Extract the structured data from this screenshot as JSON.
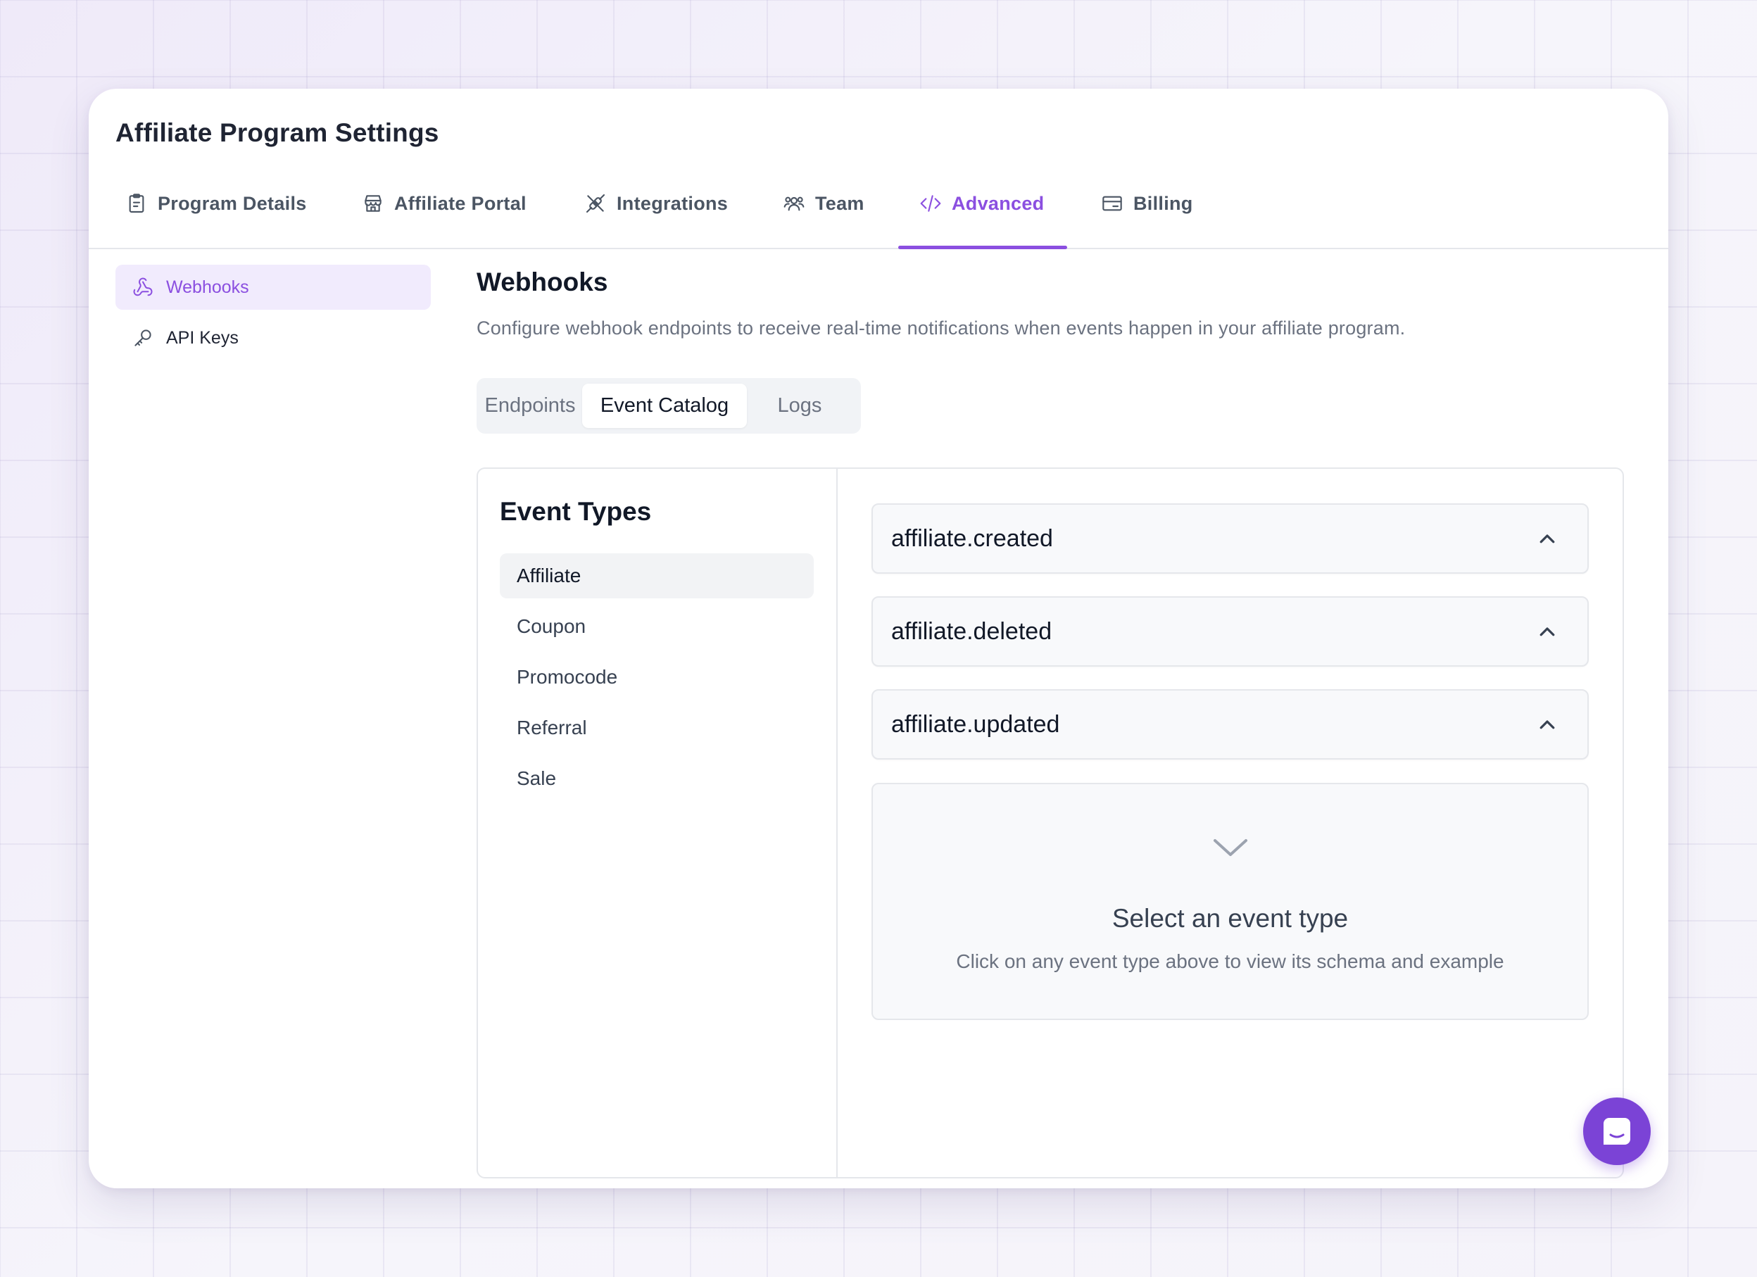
{
  "window": {
    "title": "Affiliate Program Settings"
  },
  "main_tabs": [
    {
      "label": "Program Details",
      "icon": "clipboard-icon"
    },
    {
      "label": "Affiliate Portal",
      "icon": "storefront-icon"
    },
    {
      "label": "Integrations",
      "icon": "plug-icon"
    },
    {
      "label": "Team",
      "icon": "users-icon"
    },
    {
      "label": "Advanced",
      "icon": "code-icon",
      "active": true
    },
    {
      "label": "Billing",
      "icon": "credit-card-icon"
    }
  ],
  "sidebar": {
    "items": [
      {
        "label": "Webhooks",
        "icon": "webhook-icon",
        "active": true
      },
      {
        "label": "API Keys",
        "icon": "key-icon"
      }
    ]
  },
  "section": {
    "title": "Webhooks",
    "description": "Configure webhook endpoints to receive real-time notifications when events happen in your affiliate program."
  },
  "sub_tabs": [
    {
      "label": "Endpoints"
    },
    {
      "label": "Event Catalog",
      "active": true
    },
    {
      "label": "Logs"
    }
  ],
  "event_types": {
    "title": "Event Types",
    "items": [
      "Affiliate",
      "Coupon",
      "Promocode",
      "Referral",
      "Sale"
    ],
    "selected": "Affiliate"
  },
  "events": [
    {
      "name": "affiliate.created"
    },
    {
      "name": "affiliate.deleted"
    },
    {
      "name": "affiliate.updated"
    }
  ],
  "placeholder": {
    "title": "Select an event type",
    "subtitle": "Click on any event type above to view its schema and example"
  },
  "colors": {
    "accent": "#8b4fe0",
    "fab": "#7b43d6"
  }
}
